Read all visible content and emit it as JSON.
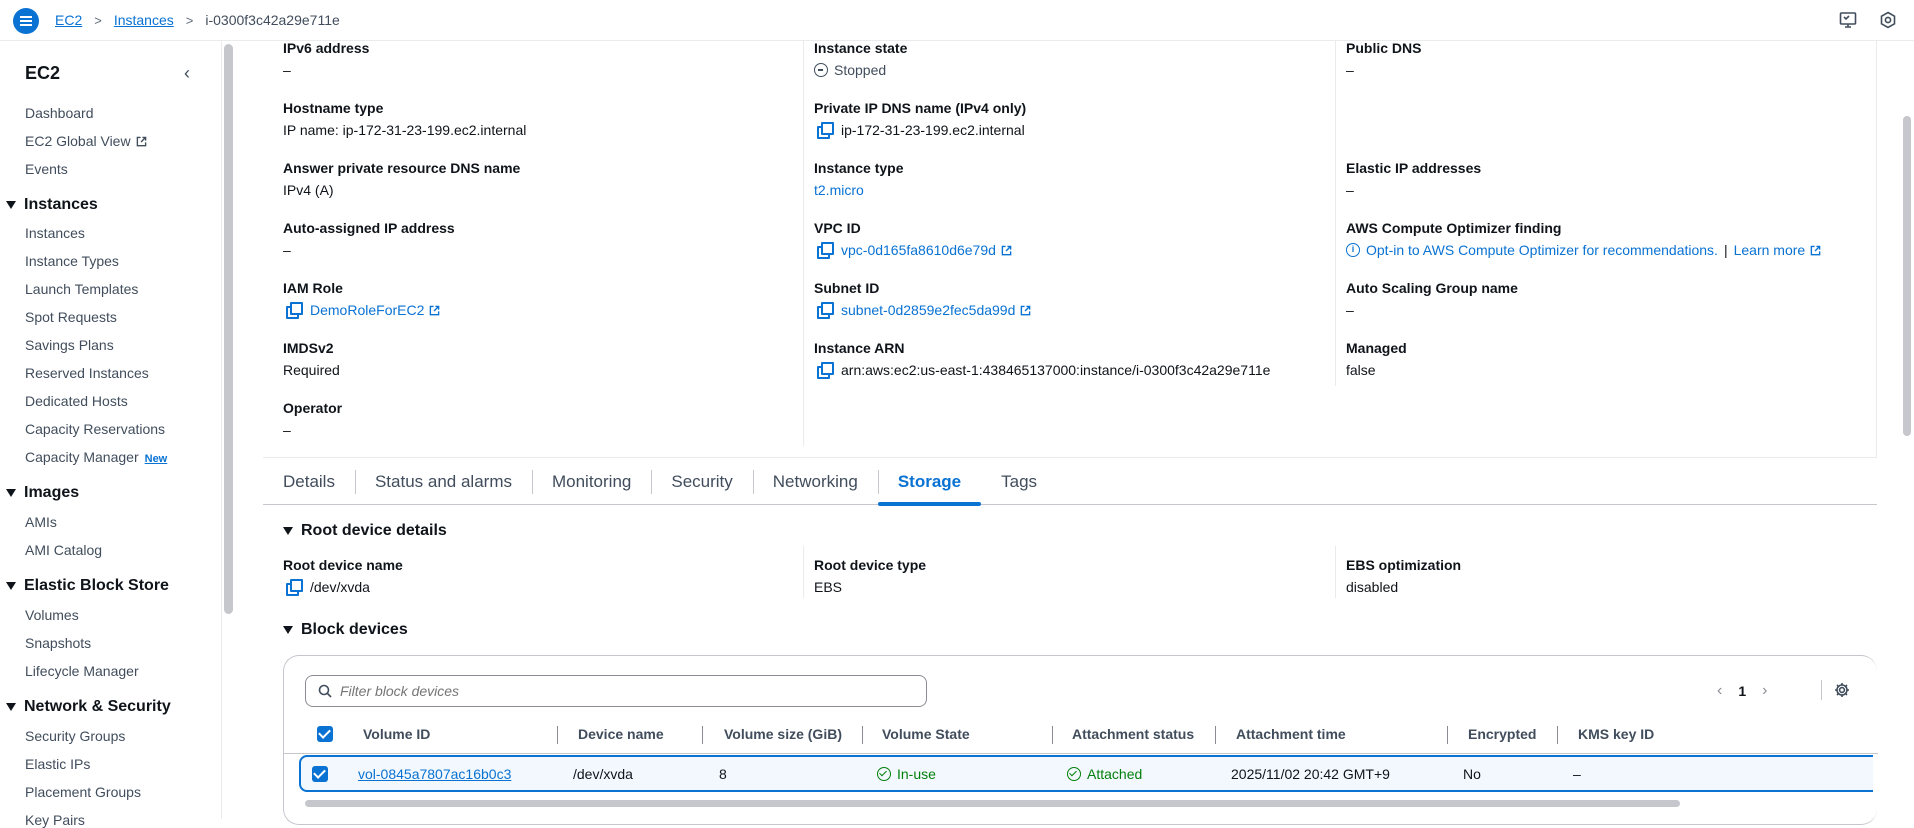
{
  "breadcrumb": {
    "root": "EC2",
    "instances": "Instances",
    "current": "i-0300f3c42a29e711e"
  },
  "sidebar": {
    "title": "EC2",
    "top_items": [
      "Dashboard",
      "EC2 Global View",
      "Events"
    ],
    "groups": [
      {
        "label": "Instances",
        "items": [
          "Instances",
          "Instance Types",
          "Launch Templates",
          "Spot Requests",
          "Savings Plans",
          "Reserved Instances",
          "Dedicated Hosts",
          "Capacity Reservations",
          "Capacity Manager"
        ]
      },
      {
        "label": "Images",
        "items": [
          "AMIs",
          "AMI Catalog"
        ]
      },
      {
        "label": "Elastic Block Store",
        "items": [
          "Volumes",
          "Snapshots",
          "Lifecycle Manager"
        ]
      },
      {
        "label": "Network & Security",
        "items": [
          "Security Groups",
          "Elastic IPs",
          "Placement Groups",
          "Key Pairs"
        ]
      }
    ],
    "new_badge": "New"
  },
  "details": {
    "col1": [
      {
        "label": "IPv6 address",
        "value": "–"
      },
      {
        "label": "Hostname type",
        "value": "IP name: ip-172-31-23-199.ec2.internal"
      },
      {
        "label": "Answer private resource DNS name",
        "value": "IPv4 (A)"
      },
      {
        "label": "Auto-assigned IP address",
        "value": "–"
      },
      {
        "label": "IAM Role",
        "value": "DemoRoleForEC2"
      },
      {
        "label": "IMDSv2",
        "value": "Required"
      },
      {
        "label": "Operator",
        "value": "–"
      }
    ],
    "col2": [
      {
        "label": "Instance state",
        "value": "Stopped"
      },
      {
        "label": "Private IP DNS name (IPv4 only)",
        "value": "ip-172-31-23-199.ec2.internal"
      },
      {
        "label": "Instance type",
        "value": "t2.micro"
      },
      {
        "label": "VPC ID",
        "value": "vpc-0d165fa8610d6e79d"
      },
      {
        "label": "Subnet ID",
        "value": "subnet-0d2859e2fec5da99d"
      },
      {
        "label": "Instance ARN",
        "value": "arn:aws:ec2:us-east-1:438465137000:instance/i-0300f3c42a29e711e"
      }
    ],
    "col3": [
      {
        "label": "Public DNS",
        "value": "–"
      },
      {
        "label": "Elastic IP addresses",
        "value": "–"
      },
      {
        "label": "AWS Compute Optimizer finding",
        "value": "Opt-in to AWS Compute Optimizer for recommendations.",
        "sep": "|",
        "learn_more": "Learn more"
      },
      {
        "label": "Auto Scaling Group name",
        "value": "–"
      },
      {
        "label": "Managed",
        "value": "false"
      }
    ]
  },
  "tabs": [
    "Details",
    "Status and alarms",
    "Monitoring",
    "Security",
    "Networking",
    "Storage",
    "Tags"
  ],
  "active_tab": "Storage",
  "root_device": {
    "heading": "Root device details",
    "name_label": "Root device name",
    "name_value": "/dev/xvda",
    "type_label": "Root device type",
    "type_value": "EBS",
    "ebs_label": "EBS optimization",
    "ebs_value": "disabled"
  },
  "block_devices": {
    "heading": "Block devices",
    "filter_placeholder": "Filter block devices",
    "page": "1",
    "columns": [
      "Volume ID",
      "Device name",
      "Volume size (GiB)",
      "Volume State",
      "Attachment status",
      "Attachment time",
      "Encrypted",
      "KMS key ID"
    ],
    "rows": [
      {
        "volume_id": "vol-0845a7807ac16b0c3",
        "device": "/dev/xvda",
        "size": "8",
        "state": "In-use",
        "attachment": "Attached",
        "time": "2025/11/02 20:42 GMT+9",
        "encrypted": "No",
        "kms": "–"
      }
    ]
  },
  "colors": {
    "accent": "#0972d3",
    "success": "#037f0c",
    "text": "#0f141a",
    "muted": "#414d5c"
  }
}
